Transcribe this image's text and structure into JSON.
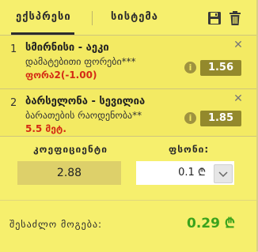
{
  "header": {
    "tab_express": "ექსპრესი",
    "tab_system": "სისტემა"
  },
  "bets": [
    {
      "index": "1",
      "title": "სმირნისი - აეკი",
      "market": "დამატებითი ფორები***",
      "selection": "ფორა2(-1.00)",
      "odds": "1.56"
    },
    {
      "index": "2",
      "title": "ბარსელონა - სევილია",
      "market": "ბარათების რაოდენობა**",
      "selection": "5.5 მეტ.",
      "odds": "1.85"
    }
  ],
  "summary": {
    "coef_label": "კოეფიციენტი",
    "coef_value": "2.88",
    "stake_label": "ფსონი:",
    "stake_value": "0.1 ₾",
    "win_label": "შესაძლო მოგება:",
    "win_value": "0.29 ₾"
  },
  "colors": {
    "panel": "#f3ea63",
    "odds_badge": "#93892c",
    "selection_text": "#d42a14",
    "win_text": "#3aa31c"
  }
}
